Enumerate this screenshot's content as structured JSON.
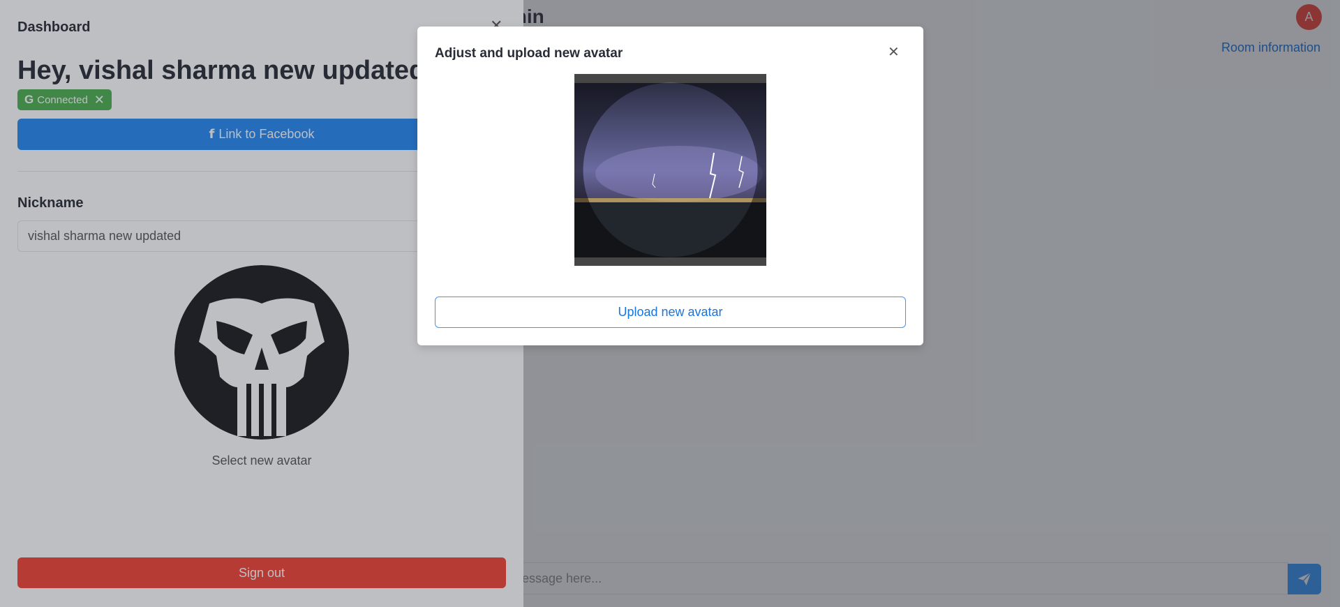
{
  "chat": {
    "title_fragment": "min",
    "user_initial": "A",
    "room_info_link": "Room information",
    "composer_placeholder": "message here...",
    "send_icon": "paper-plane-icon"
  },
  "drawer": {
    "title": "Dashboard",
    "close_icon": "close-icon",
    "greeting": "Hey, vishal sharma new updated",
    "provider_tag": {
      "icon": "google-icon",
      "icon_glyph": "G",
      "label": "Connected",
      "remove_icon": "close-icon",
      "remove_glyph": "✕"
    },
    "facebook_button": {
      "icon": "facebook-icon",
      "icon_glyph": "f",
      "label": "Link to Facebook"
    },
    "nickname_label": "Nickname",
    "nickname_value": "vishal sharma new updated",
    "avatar_hint": "Select new avatar",
    "signout_label": "Sign out"
  },
  "modal": {
    "title": "Adjust and upload new avatar",
    "close_glyph": "✕",
    "upload_label": "Upload new avatar"
  },
  "colors": {
    "primary": "#3498ff",
    "danger": "#f44336",
    "success": "#4caf50",
    "facebook": "#2589f5"
  }
}
